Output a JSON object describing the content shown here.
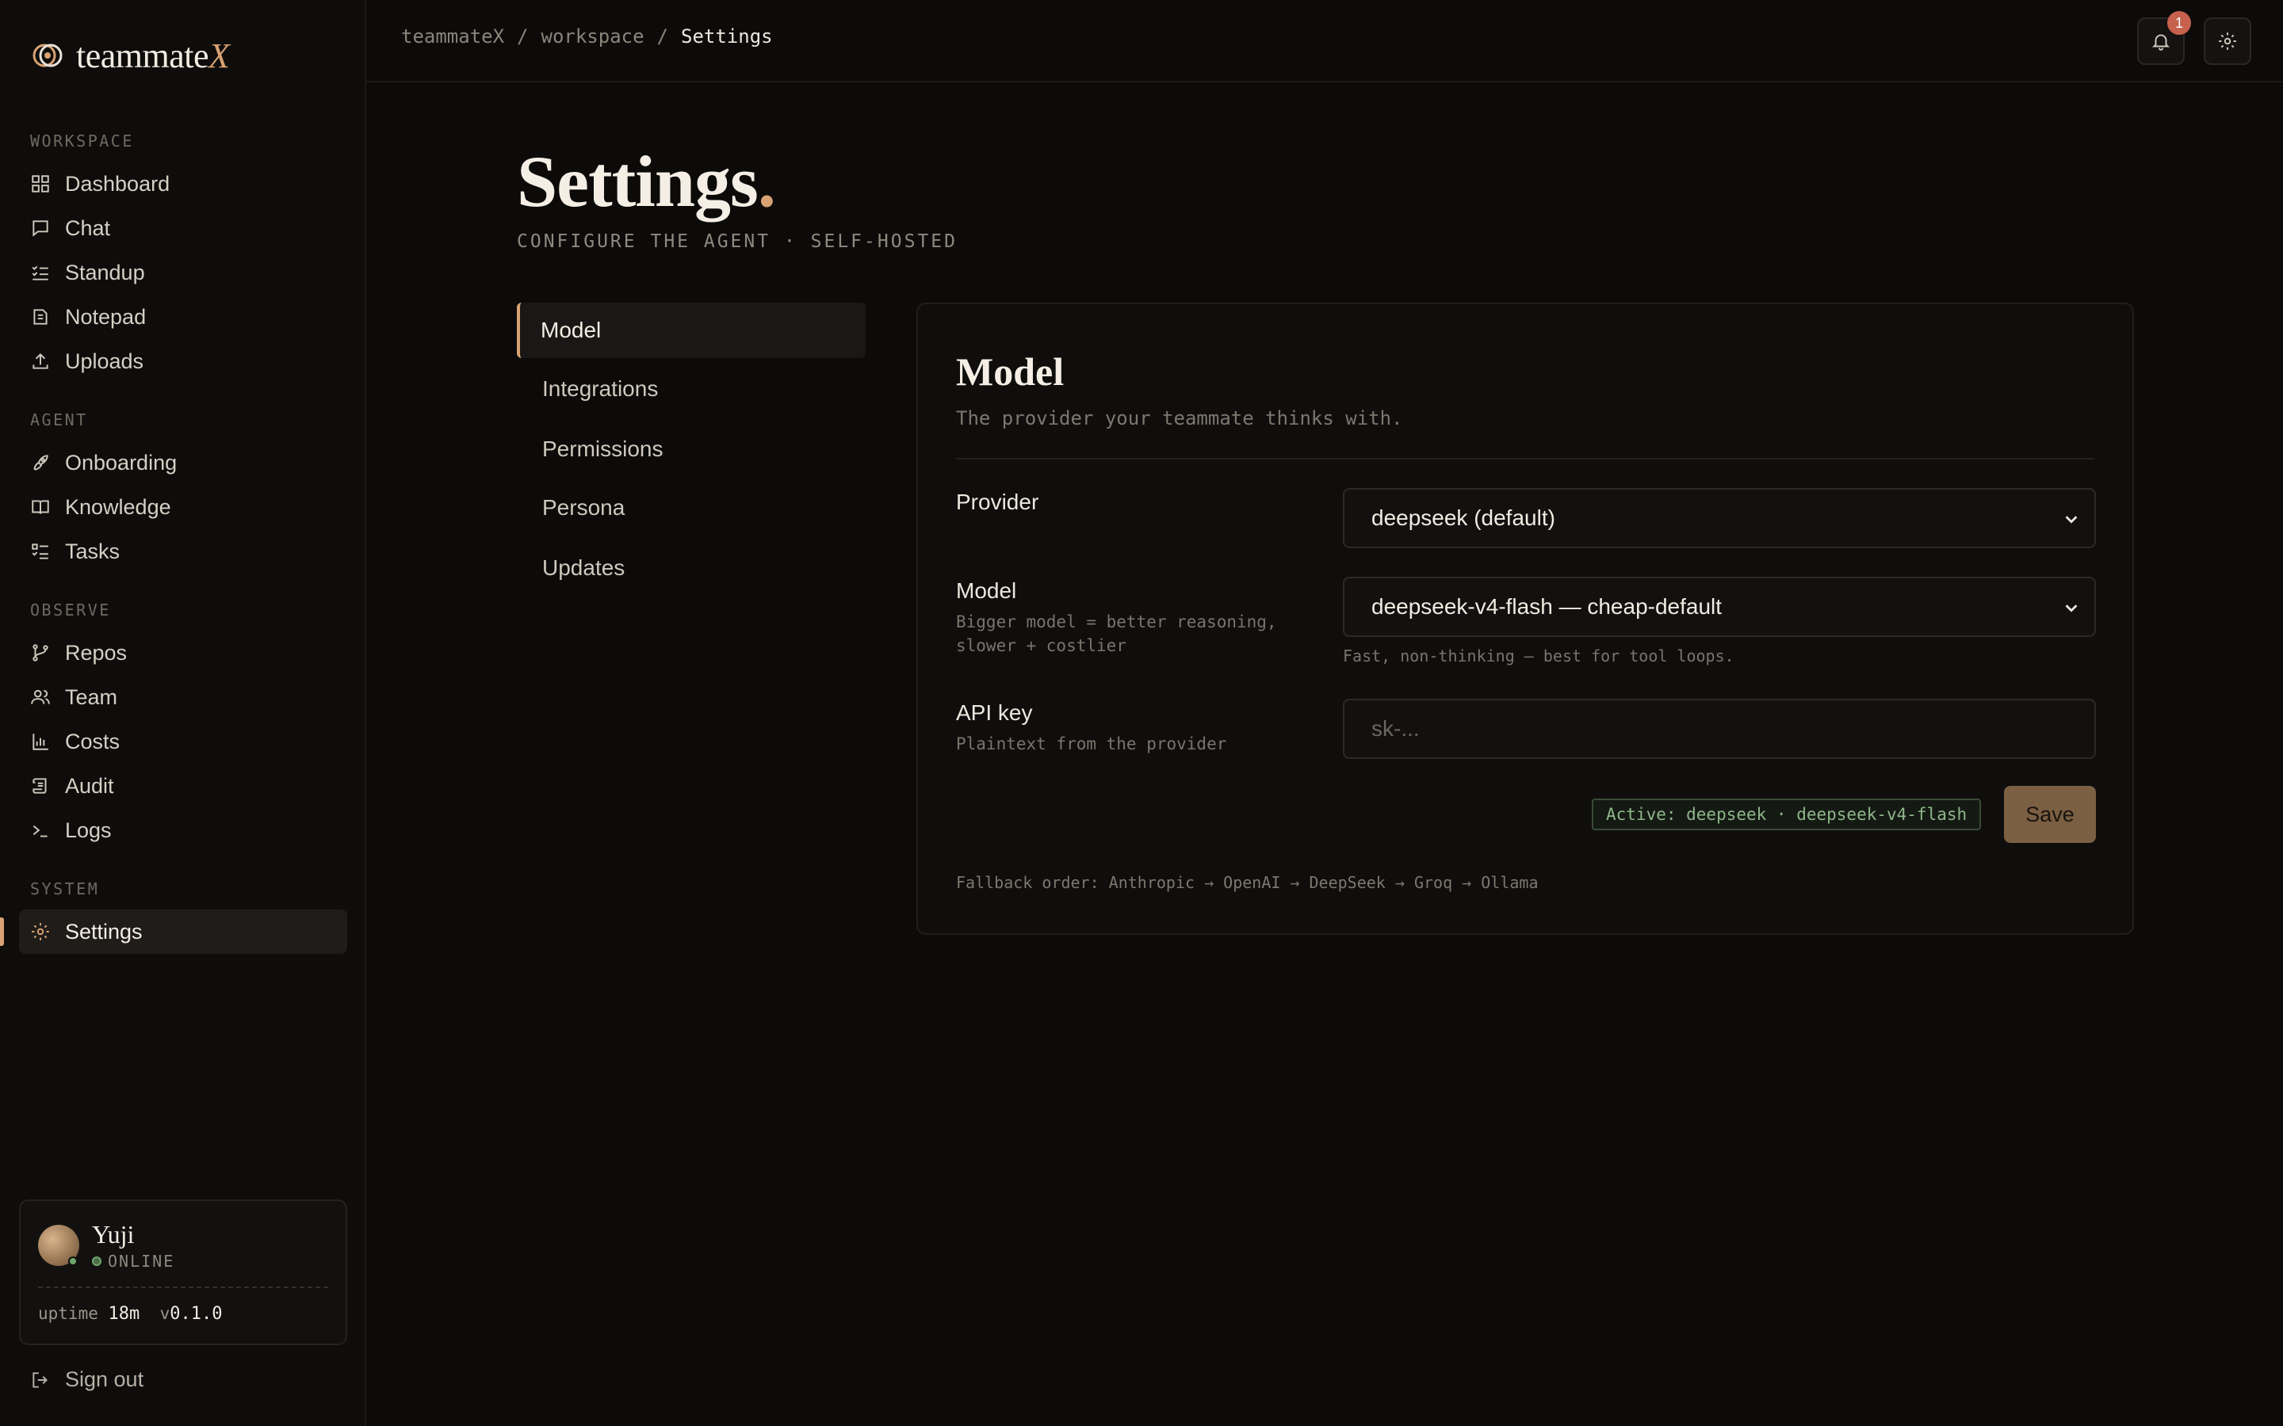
{
  "brand": {
    "name": "teammate",
    "suffix": "X"
  },
  "sidebar": {
    "sections": [
      {
        "title": "WORKSPACE",
        "items": [
          "Dashboard",
          "Chat",
          "Standup",
          "Notepad",
          "Uploads"
        ]
      },
      {
        "title": "AGENT",
        "items": [
          "Onboarding",
          "Knowledge",
          "Tasks"
        ]
      },
      {
        "title": "OBSERVE",
        "items": [
          "Repos",
          "Team",
          "Costs",
          "Audit",
          "Logs"
        ]
      },
      {
        "title": "SYSTEM",
        "items": [
          "Settings"
        ]
      }
    ],
    "active_item": "Settings",
    "user": {
      "name": "Yuji",
      "status": "ONLINE",
      "uptime_label": "uptime",
      "uptime": "18m",
      "version_prefix": "v",
      "version": "0.1.0"
    },
    "signout_label": "Sign out"
  },
  "header": {
    "breadcrumb": [
      "teammateX",
      "workspace",
      "Settings"
    ],
    "notifications_count": "1"
  },
  "page": {
    "title": "Settings",
    "title_dot": ".",
    "subtitle": "CONFIGURE THE AGENT · SELF-HOSTED"
  },
  "tabs": [
    "Model",
    "Integrations",
    "Permissions",
    "Persona",
    "Updates"
  ],
  "active_tab": "Model",
  "panel": {
    "title": "Model",
    "subtitle": "The provider your teammate thinks with.",
    "provider": {
      "label": "Provider",
      "value": "deepseek (default)"
    },
    "model": {
      "label": "Model",
      "help": "Bigger model = better reasoning, slower + costlier",
      "value": "deepseek-v4-flash — cheap-default",
      "note": "Fast, non-thinking — best for tool loops."
    },
    "api_key": {
      "label": "API key",
      "help": "Plaintext from the provider",
      "placeholder": "sk-..."
    },
    "active_chip": "Active: deepseek · deepseek-v4-flash",
    "save_label": "Save",
    "fallback": "Fallback order: Anthropic → OpenAI → DeepSeek → Groq → Ollama"
  },
  "colors": {
    "accent": "#d9a272",
    "background": "#0c0b0a",
    "success": "#6fa86a",
    "badge": "#c6614e"
  }
}
